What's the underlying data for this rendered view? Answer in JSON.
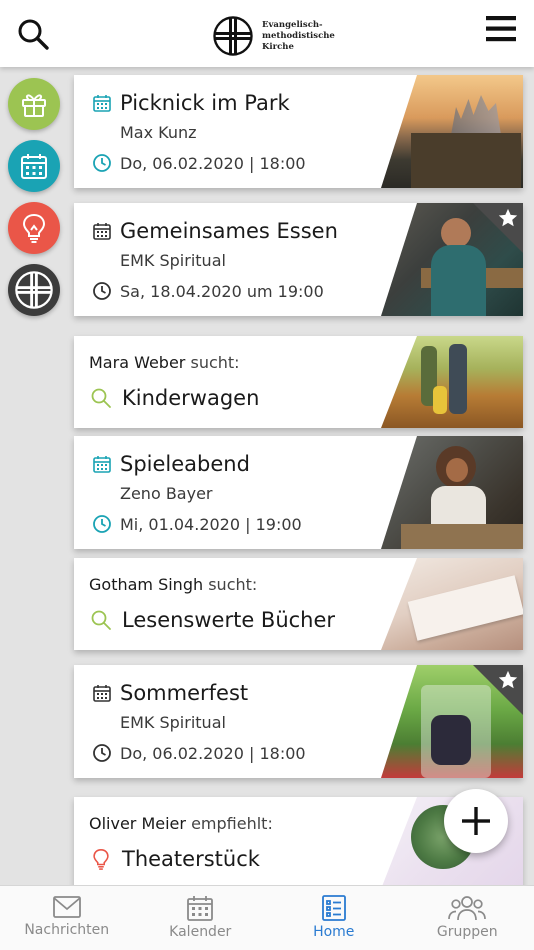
{
  "header": {
    "logo_lines": [
      "Evangelisch-",
      "methodistische",
      "Kirche"
    ]
  },
  "rail": [
    {
      "name": "gift",
      "color": "#9cc452"
    },
    {
      "name": "calendar",
      "color": "#1aa3b4"
    },
    {
      "name": "lightbulb",
      "color": "#ea5648"
    },
    {
      "name": "church",
      "color": "#3c3c3c"
    }
  ],
  "cards": [
    {
      "kind": "event",
      "title": "Picknick im Park",
      "organizer": "Max Kunz",
      "datetime": "Do, 06.02.2020 | 18:00",
      "accent": "#1aa3b4",
      "starred": false
    },
    {
      "kind": "event",
      "title": "Gemeinsames Essen",
      "organizer": "EMK Spiritual",
      "datetime": "Sa, 18.04.2020 um 19:00",
      "accent": "#333333",
      "starred": true
    },
    {
      "kind": "search",
      "person": "Mara Weber",
      "verb": "sucht:",
      "item": "Kinderwagen",
      "accent": "#9cc452"
    },
    {
      "kind": "event",
      "title": "Spieleabend",
      "organizer": "Zeno Bayer",
      "datetime": "Mi, 01.04.2020 | 19:00",
      "accent": "#1aa3b4",
      "starred": false
    },
    {
      "kind": "search",
      "person": "Gotham Singh",
      "verb": "sucht:",
      "item": "Lesenswerte Bücher",
      "accent": "#9cc452"
    },
    {
      "kind": "event",
      "title": "Sommerfest",
      "organizer": "EMK Spiritual",
      "datetime": "Do, 06.02.2020 | 18:00",
      "accent": "#333333",
      "starred": true
    },
    {
      "kind": "recommend",
      "person": "Oliver Meier",
      "verb": "empfiehlt:",
      "item": "Theaterstück",
      "accent": "#ea5648"
    }
  ],
  "nav": [
    {
      "label": "Nachrichten",
      "icon": "mail-icon",
      "active": false
    },
    {
      "label": "Kalender",
      "icon": "calendar-icon",
      "active": false
    },
    {
      "label": "Home",
      "icon": "list-icon",
      "active": true
    },
    {
      "label": "Gruppen",
      "icon": "group-icon",
      "active": false
    }
  ],
  "colors": {
    "active": "#2a7bd1",
    "teal": "#1aa3b4",
    "green": "#9cc452",
    "red": "#ea5648"
  }
}
